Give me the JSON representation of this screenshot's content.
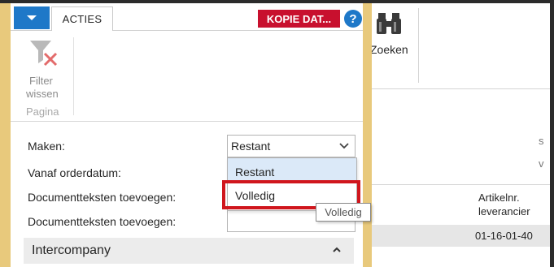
{
  "menu": {
    "tab_label": "ACTIES"
  },
  "header": {
    "company_badge": "KOPIE DAT...",
    "help_glyph": "?"
  },
  "ribbon": {
    "filter_label_line1": "Filter",
    "filter_label_line2": "wissen",
    "group_label": "Pagina",
    "filter_icon": "filter-clear-icon"
  },
  "form": {
    "fields": [
      {
        "label": "Maken:"
      },
      {
        "label": "Vanaf orderdatum:"
      },
      {
        "label": "Documentteksten toevoegen:"
      },
      {
        "label": "Documentteksten toevoegen:"
      }
    ],
    "maken_value": "Restant",
    "dropdown_options": [
      "Restant",
      "Volledig"
    ],
    "tooltip": "Volledig"
  },
  "section": {
    "title": "Intercompany"
  },
  "background_page": {
    "search_label": "Zoeken",
    "mark1": "s",
    "mark2": "v",
    "column_header_line1": "Artikelnr.",
    "column_header_line2": "leverancier",
    "row_value": "01-16-01-40"
  },
  "colors": {
    "accent_blue": "#1e78c8",
    "badge_red": "#c8102e",
    "highlight_red": "#d0161d",
    "frame_yellow": "#e8c97c"
  }
}
